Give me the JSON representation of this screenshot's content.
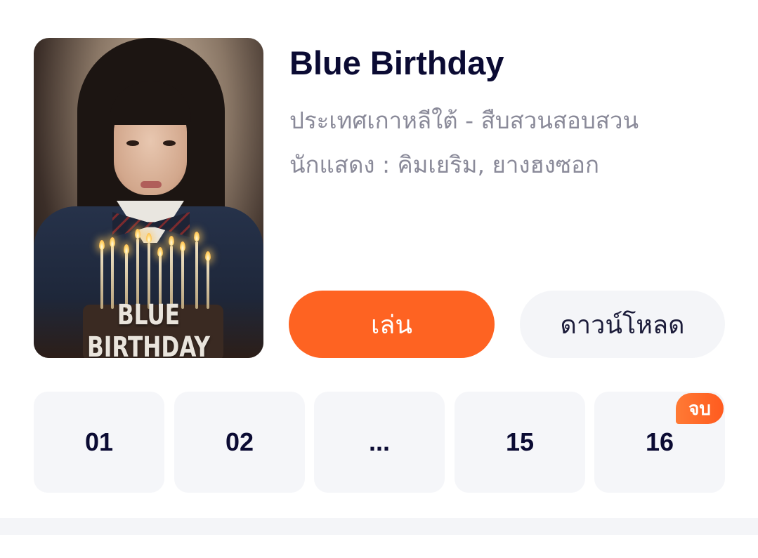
{
  "show": {
    "title": "Blue Birthday",
    "poster_title": "BLUE BIRTHDAY",
    "meta_line": "ประเทศเกาหลีใต้ - สืบสวนสอบสวน",
    "cast_line": "นักแสดง : คิมเยริม, ยางฮงซอก"
  },
  "actions": {
    "play_label": "เล่น",
    "download_label": "ดาวน์โหลด"
  },
  "episodes": {
    "items": [
      "01",
      "02",
      "...",
      "15",
      "16"
    ],
    "final_badge": "จบ"
  },
  "colors": {
    "accent": "#fe6322",
    "title_text": "#0b0b33",
    "meta_text": "#8a8a99",
    "tile_bg": "#f5f6f9"
  }
}
